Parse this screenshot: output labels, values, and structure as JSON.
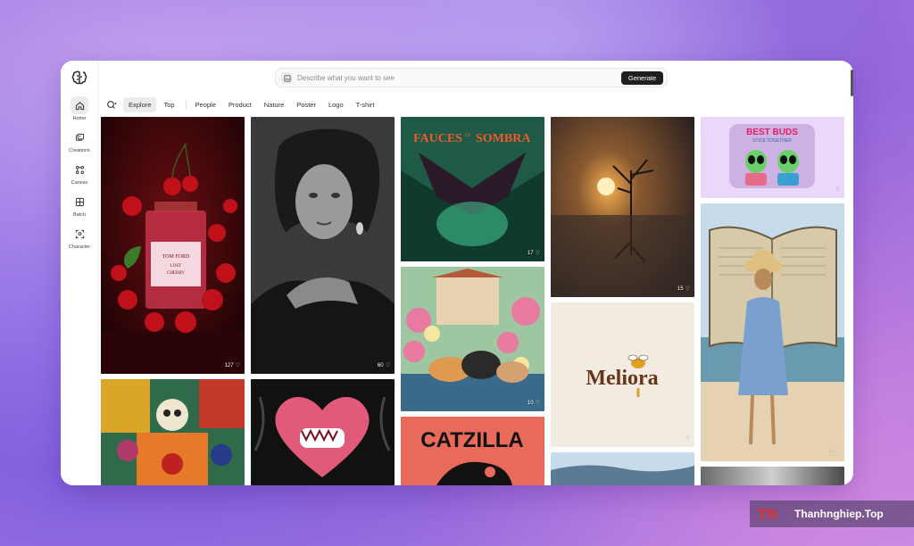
{
  "sidebar": {
    "items": [
      {
        "label": "Home",
        "icon": "home-icon",
        "active": true
      },
      {
        "label": "Creations",
        "icon": "images-icon"
      },
      {
        "label": "Canvas",
        "icon": "nodes-icon"
      },
      {
        "label": "Batch",
        "icon": "grid-plus-icon"
      },
      {
        "label": "Character",
        "icon": "face-scan-icon"
      }
    ]
  },
  "prompt": {
    "placeholder": "Describe what you want to see",
    "generate_label": "Generate"
  },
  "tabs": [
    {
      "label": "Explore",
      "active": true
    },
    {
      "label": "Top"
    },
    {
      "label": "People"
    },
    {
      "label": "Product"
    },
    {
      "label": "Nature"
    },
    {
      "label": "Poster"
    },
    {
      "label": "Logo"
    },
    {
      "label": "T-shirt"
    }
  ],
  "cards": {
    "perfume": {
      "likes": "127",
      "brand": "TOM FORD",
      "name1": "LOST",
      "name2": "CHERRY"
    },
    "portrait": {
      "likes": "60"
    },
    "poster": {
      "likes": "17",
      "title": "FAUCES",
      "title_small": "DE",
      "title2": "SOMBRA"
    },
    "tree": {
      "likes": "15"
    },
    "bestbuds": {
      "line1": "BEST BUDS",
      "line2": "STICK TOGETHER"
    },
    "girl": {
      "likes": "1"
    },
    "cats": {
      "likes": "10"
    },
    "meliora": {
      "text": "Meliora"
    },
    "catzilla": {
      "text": "CATZILLA"
    }
  },
  "watermark": {
    "text": "Thanhnghiep.Top",
    "logo": "TN"
  },
  "colors": {
    "accent": "#1f1f1f",
    "active_tab": "#ececec"
  }
}
